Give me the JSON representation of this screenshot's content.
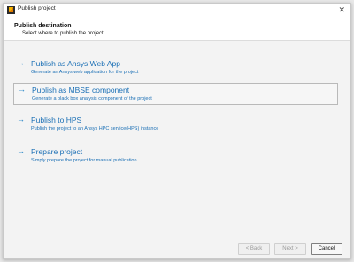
{
  "window": {
    "title": "Publish project",
    "close_glyph": "✕"
  },
  "header": {
    "title": "Publish destination",
    "subtitle": "Select where to publish the project"
  },
  "options": [
    {
      "arrow": "→",
      "title": "Publish as Ansys Web App",
      "description": "Generate an Ansys web application for the project",
      "selected": false
    },
    {
      "arrow": "→",
      "title": "Publish as MBSE component",
      "description": "Generate a black box analysis component of the project",
      "selected": true
    },
    {
      "arrow": "→",
      "title": "Publish to HPS",
      "description": "Publish the project to an Ansys HPC service(HPS) instance",
      "selected": false
    },
    {
      "arrow": "→",
      "title": "Prepare project",
      "description": "Simply prepare the project for manual publication",
      "selected": false
    }
  ],
  "footer": {
    "back_label": "< Back",
    "next_label": "Next >",
    "cancel_label": "Cancel"
  },
  "colors": {
    "link": "#1a6fb5",
    "arrow": "#1b7fc4",
    "dialog_bg": "#f3f3f3"
  }
}
